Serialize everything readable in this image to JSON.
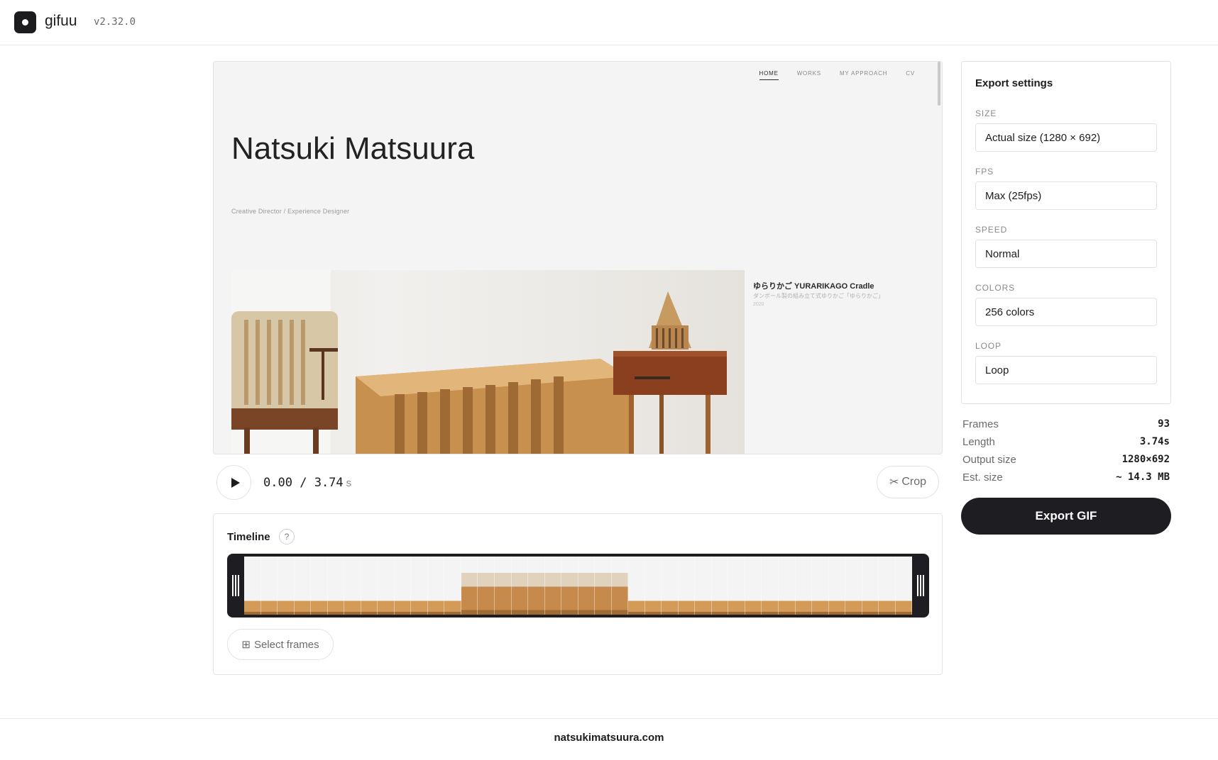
{
  "app": {
    "name": "gifuu",
    "version": "v2.32.0"
  },
  "preview": {
    "nav": [
      "HOME",
      "WORKS",
      "MY APPROACH",
      "CV"
    ],
    "site_title": "Natsuki Matsuura",
    "site_subtitle": "Creative Director / Experience Designer",
    "project_title": "ゆらりかご YURARIKAGO Cradle",
    "project_desc": "ダンボール製の組み立て式ゆりかご「ゆらりかご」",
    "project_year": "2020"
  },
  "player": {
    "current": "0.00",
    "separator": "/",
    "total": "3.74",
    "unit": "s",
    "crop_label": "Crop",
    "crop_icon": "scissors-icon"
  },
  "timeline": {
    "label": "Timeline",
    "help": "?",
    "select_label": "Select frames",
    "select_icon": "grid-icon",
    "frame_count": 93
  },
  "export": {
    "title": "Export settings",
    "fields": [
      {
        "label": "SIZE",
        "value": "Actual size (1280 × 692)"
      },
      {
        "label": "FPS",
        "value": "Max (25fps)"
      },
      {
        "label": "SPEED",
        "value": "Normal"
      },
      {
        "label": "COLORS",
        "value": "256 colors"
      },
      {
        "label": "LOOP",
        "value": "Loop"
      }
    ],
    "stats": [
      {
        "label": "Frames",
        "value": "93"
      },
      {
        "label": "Length",
        "value": "3.74s"
      },
      {
        "label": "Output size",
        "value": "1280×692"
      },
      {
        "label": "Est. size",
        "value": "~ 14.3 MB"
      }
    ],
    "button": "Export GIF"
  },
  "footer": {
    "link": "natsukimatsuura.com"
  },
  "colors": {
    "accent": "#1e1e22",
    "border": "#e3e3e3",
    "muted": "#8a8a8a",
    "wood": "#d49a57"
  }
}
